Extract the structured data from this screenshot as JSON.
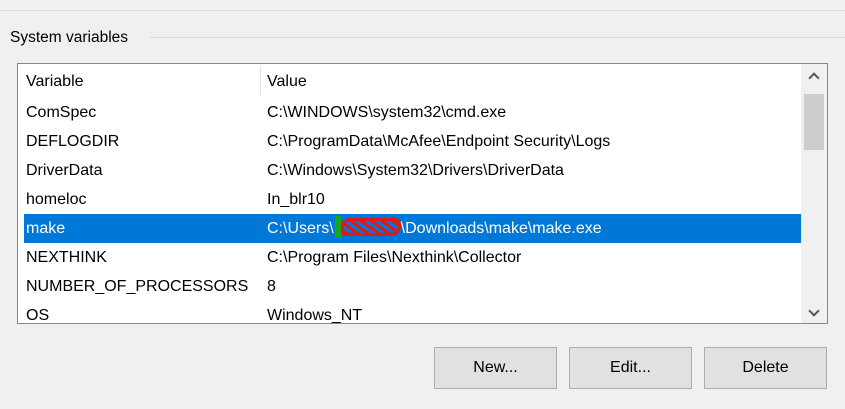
{
  "group": {
    "title": "System variables"
  },
  "table": {
    "columns": [
      "Variable",
      "Value"
    ],
    "rows": [
      {
        "variable": "ComSpec",
        "value": "C:\\WINDOWS\\system32\\cmd.exe"
      },
      {
        "variable": "DEFLOGDIR",
        "value": "C:\\ProgramData\\McAfee\\Endpoint Security\\Logs"
      },
      {
        "variable": "DriverData",
        "value": "C:\\Windows\\System32\\Drivers\\DriverData"
      },
      {
        "variable": "homeloc",
        "value": "In_blr10"
      },
      {
        "variable": "make",
        "value_prefix": "C:\\Users\\",
        "value_suffix": "\\Downloads\\make\\make.exe",
        "selected": true
      },
      {
        "variable": "NEXTHINK",
        "value": "C:\\Program Files\\Nexthink\\Collector"
      },
      {
        "variable": "NUMBER_OF_PROCESSORS",
        "value": "8"
      },
      {
        "variable": "OS",
        "value": "Windows_NT"
      }
    ]
  },
  "scrollbar": {
    "up_icon": "chevron-up-icon",
    "down_icon": "chevron-down-icon"
  },
  "buttons": {
    "new": "New...",
    "edit": "Edit...",
    "delete": "Delete"
  },
  "colors": {
    "selection": "#0078d7",
    "background": "#f0f0f0",
    "list_bg": "#ffffff"
  }
}
